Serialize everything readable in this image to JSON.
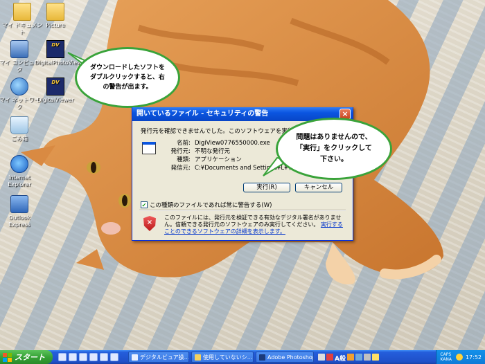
{
  "desktop_icons": [
    {
      "label": "マイ ドキュメント",
      "icon": "my-documents-icon"
    },
    {
      "label": "Picture",
      "icon": "folder-icon"
    },
    {
      "label": "マイ コンピュータ",
      "icon": "my-computer-icon"
    },
    {
      "label": "DigitalPhotoViewer",
      "icon": "digital-viewer-icon"
    },
    {
      "label": "マイ ネットワーク",
      "icon": "network-icon"
    },
    {
      "label": "DigitalViewer",
      "icon": "digital-viewer-icon"
    },
    {
      "label": "ごみ箱",
      "icon": "recycle-bin-icon"
    },
    {
      "label": "Internet Explorer",
      "icon": "internet-explorer-icon"
    },
    {
      "label": "Outlook Express",
      "icon": "outlook-express-icon"
    }
  ],
  "bubble1": {
    "text": "ダウンロードしたソフトを\nダブルクリックすると、右\nの警告が出ます。"
  },
  "bubble2": {
    "text": "問題はありませんので、\n「実行」をクリックして\n下さい。"
  },
  "dialog": {
    "title": "開いているファイル - セキュリティの警告",
    "question": "発行元を確認できませんでした。このソフトウェアを実行しますか?",
    "properties": [
      {
        "key": "名前:",
        "value": "DigiView0776550000.exe"
      },
      {
        "key": "発行元:",
        "value": "不明な発行元"
      },
      {
        "key": "種類:",
        "value": "アプリケーション"
      },
      {
        "key": "発信元:",
        "value": "C:¥Documents and Settings¥L¥デスクトップ"
      }
    ],
    "run_label": "実行(R)",
    "cancel_label": "キャンセル",
    "checkbox_label": "この種類のファイルであれば常に警告する(W)",
    "warning_text": "このファイルには、発行元を検証できる有効なデジタル署名がありません。信頼できる発行元のソフトウェアのみ実行してください。",
    "warning_link": "実行することのできるソフトウェアの詳細を表示します。"
  },
  "taskbar": {
    "start_label": "スタート",
    "tasks": [
      {
        "label": "デジタルビュア操...",
        "icon": "window-icon"
      },
      {
        "label": "使用していないシ...",
        "icon": "folder-icon"
      },
      {
        "label": "Adobe Photoshop",
        "icon": "photoshop-icon"
      }
    ],
    "ime_label": "A般",
    "caps": "CAPS",
    "kana": "KANA",
    "clock": "17:52"
  }
}
